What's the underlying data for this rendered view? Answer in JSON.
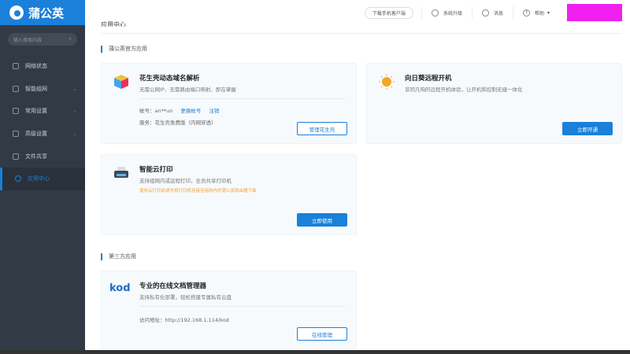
{
  "brand": "蒲公英",
  "sidebar": {
    "search_placeholder": "输入搜索内容",
    "items": [
      {
        "label": "网络状态"
      },
      {
        "label": "智能组网"
      },
      {
        "label": "常用设置"
      },
      {
        "label": "高级设置"
      },
      {
        "label": "文件共享"
      },
      {
        "label": "应用中心"
      }
    ]
  },
  "topbar": {
    "download": "下载手机客户端",
    "upgrade": "系统升级",
    "messages": "消息",
    "help": "帮助"
  },
  "page_title": "应用中心",
  "sections": {
    "official": "蒲公英官方应用",
    "third": "第三方应用"
  },
  "cards": {
    "ddns": {
      "title": "花生壳动态域名解析",
      "desc": "无需公网IP、无需路由端口映射、即在掌握",
      "account_label": "帐号：",
      "account": "an**un",
      "change": "更换帐号",
      "logout": "注销",
      "service": "服务：花生壳免费版（内网穿透）",
      "button": "管理花生壳"
    },
    "sunflower": {
      "title": "向日葵远程开机",
      "desc": "非同凡响的远程开机体验，让开机和控制无缝一体化",
      "button": "立即开通"
    },
    "print": {
      "title": "智能云打印",
      "desc": "支持组网内或远程打印，全员共享打印机",
      "note": "使用云打印前请先将打印机连接至组网内的蒲公英路由器下面",
      "button": "立即使用"
    },
    "kod": {
      "logo": "kod",
      "title": "专业的在线文档管理器",
      "desc": "支持私有化部署，轻松搭建专属私有云盘",
      "addr": "访问地址：http://192.168.1.114/kod",
      "button": "在线管理"
    }
  }
}
